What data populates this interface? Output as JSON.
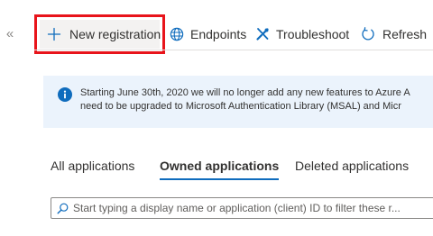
{
  "nav": {
    "collapse_glyph": "«"
  },
  "toolbar": {
    "new_registration": {
      "label": "New registration",
      "icon": "plus-icon"
    },
    "endpoints": {
      "label": "Endpoints",
      "icon": "globe-icon"
    },
    "troubleshoot": {
      "label": "Troubleshoot",
      "icon": "wrench-icon"
    },
    "refresh": {
      "label": "Refresh",
      "icon": "refresh-icon"
    }
  },
  "banner": {
    "icon": "info-icon",
    "line1": "Starting June 30th, 2020 we will no longer add any new features to Azure A",
    "line2": "need to be upgraded to Microsoft Authentication Library (MSAL) and Micr"
  },
  "tabs": {
    "all": "All applications",
    "owned": "Owned applications",
    "deleted": "Deleted applications",
    "selected": "owned"
  },
  "search": {
    "icon": "search-icon",
    "placeholder": "Start typing a display name or application (client) ID to filter these r...",
    "value": ""
  },
  "colors": {
    "accent": "#0f6cbd",
    "highlight_border": "#e8141b",
    "banner_bg": "#ebf3fc"
  }
}
